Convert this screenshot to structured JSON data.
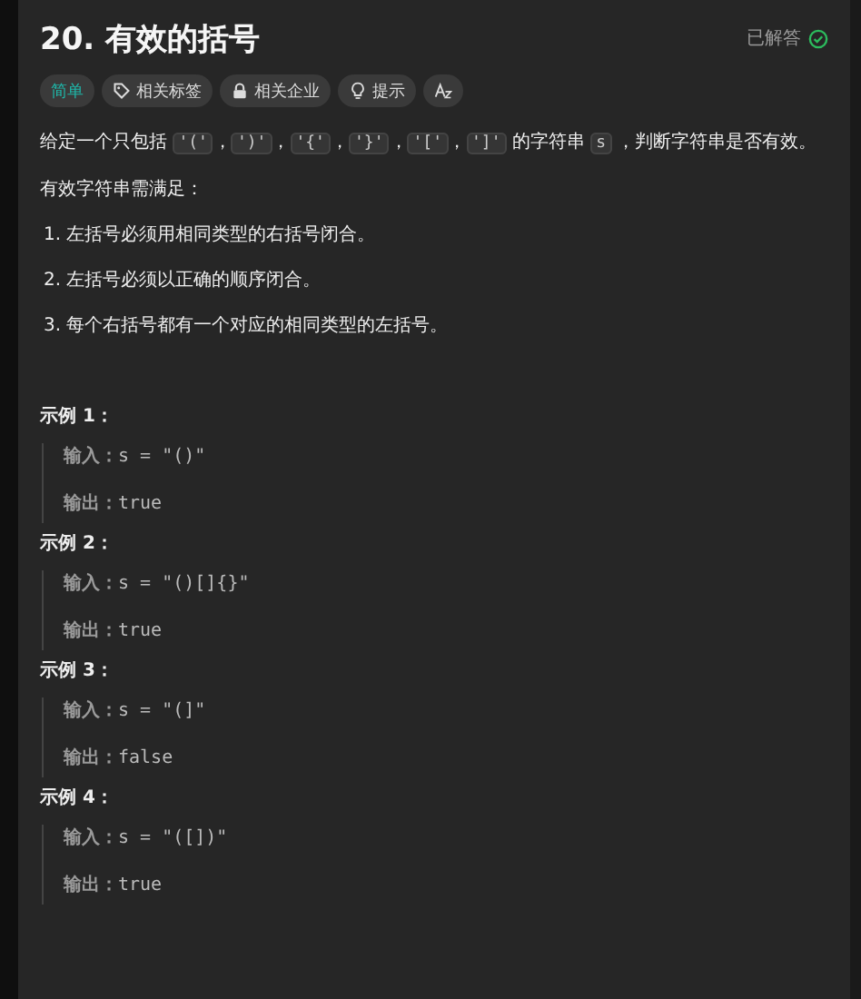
{
  "problem": {
    "title": "20. 有效的括号",
    "status": "已解答",
    "solved": true
  },
  "tags": [
    {
      "kind": "difficulty",
      "label": "简单"
    },
    {
      "kind": "topic",
      "label": "相关标签"
    },
    {
      "kind": "company",
      "label": "相关企业"
    },
    {
      "kind": "hint",
      "label": "提示"
    },
    {
      "kind": "font"
    }
  ],
  "description": [
    {
      "kind": "text",
      "text": "给定一个只包括 "
    },
    {
      "kind": "code",
      "text": "'('"
    },
    {
      "kind": "text",
      "text": "，"
    },
    {
      "kind": "code",
      "text": "')'"
    },
    {
      "kind": "text",
      "text": "，"
    },
    {
      "kind": "code",
      "text": "'{'"
    },
    {
      "kind": "text",
      "text": "，"
    },
    {
      "kind": "code",
      "text": "'}'"
    },
    {
      "kind": "text",
      "text": "，"
    },
    {
      "kind": "code",
      "text": "'['"
    },
    {
      "kind": "text",
      "text": "，"
    },
    {
      "kind": "code",
      "text": "']'"
    },
    {
      "kind": "text",
      "text": " 的字符串 "
    },
    {
      "kind": "code",
      "text": "s"
    },
    {
      "kind": "text",
      "text": " ，判断字符串是否有效。"
    }
  ],
  "rules_intro": "有效字符串需满足：",
  "rules": [
    "1. 左括号必须用相同类型的右括号闭合。",
    "2. 左括号必须以正确的顺序闭合。",
    "3. 每个右括号都有一个对应的相同类型的左括号。"
  ],
  "examples": [
    {
      "heading": "示例 1：",
      "input_label": "输入：",
      "input": "s = \"()\"",
      "output_label": "输出：",
      "output": "true"
    },
    {
      "heading": "示例 2：",
      "input_label": "输入：",
      "input": "s = \"()[]{}\"",
      "output_label": "输出：",
      "output": "true"
    },
    {
      "heading": "示例 3：",
      "input_label": "输入：",
      "input": "s = \"(]\"",
      "output_label": "输出：",
      "output": "false"
    },
    {
      "heading": "示例 4：",
      "input_label": "输入：",
      "input": "s = \"([])\"",
      "output_label": "输出：",
      "output": "true"
    }
  ]
}
